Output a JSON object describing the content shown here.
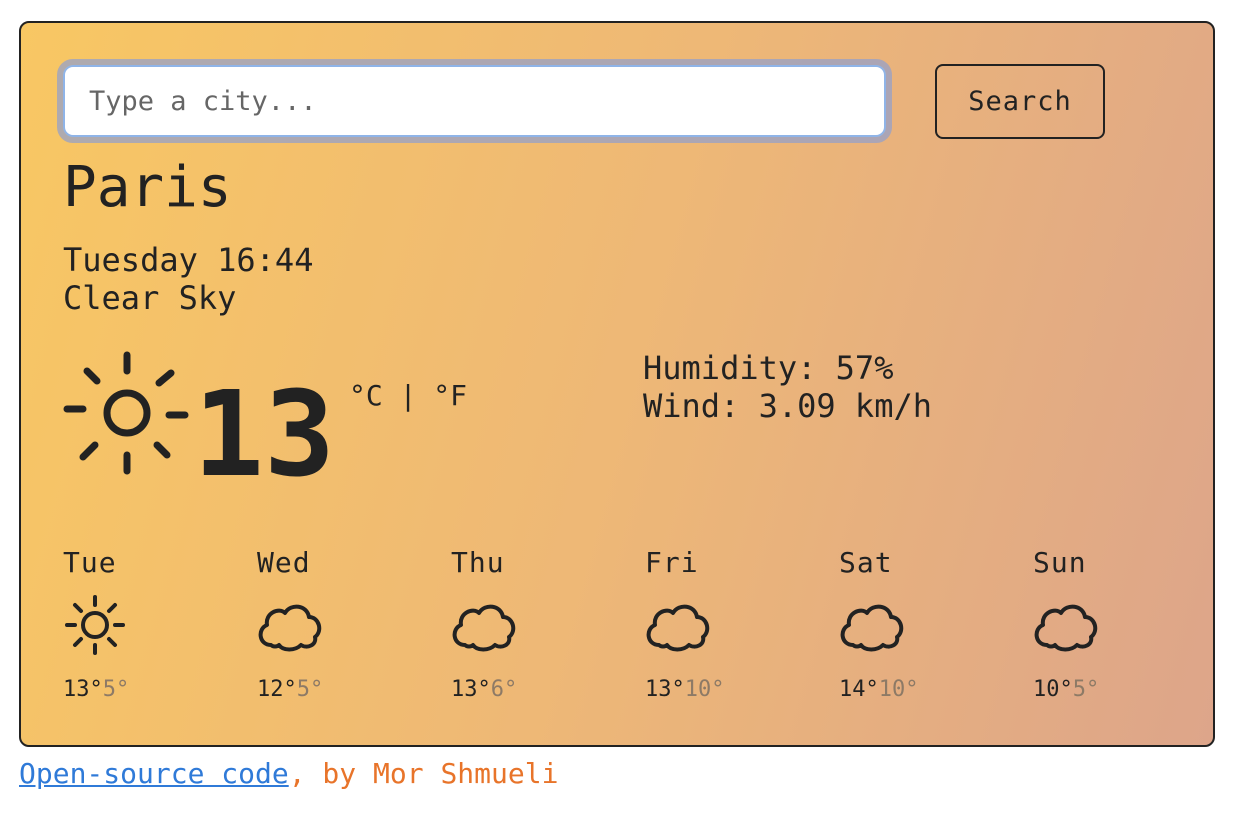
{
  "search": {
    "placeholder": "Type a city...",
    "button_label": "Search"
  },
  "current": {
    "city": "Paris",
    "datetime": "Tuesday 16:44",
    "description": "Clear Sky",
    "icon": "sun-icon",
    "temperature": "13",
    "unit_c": "°C",
    "unit_sep": " | ",
    "unit_f": "°F",
    "humidity": "Humidity: 57%",
    "wind": "Wind: 3.09 km/h"
  },
  "forecast": [
    {
      "day": "Tue",
      "icon": "sun-icon",
      "max": "13°",
      "min": "5°"
    },
    {
      "day": "Wed",
      "icon": "cloud-icon",
      "max": "12°",
      "min": "5°"
    },
    {
      "day": "Thu",
      "icon": "cloud-icon",
      "max": "13°",
      "min": "6°"
    },
    {
      "day": "Fri",
      "icon": "cloud-icon",
      "max": "13°",
      "min": "10°"
    },
    {
      "day": "Sat",
      "icon": "cloud-icon",
      "max": "14°",
      "min": "10°"
    },
    {
      "day": "Sun",
      "icon": "cloud-icon",
      "max": "10°",
      "min": "5°"
    }
  ],
  "footer": {
    "link_text": "Open-source code",
    "separator": ",",
    "author_text": " by Mor Shmueli"
  },
  "colors": {
    "gradient_start": "#f8c763",
    "gradient_end": "#dda58a",
    "link": "#2f7ad8",
    "author": "#e8742a"
  }
}
